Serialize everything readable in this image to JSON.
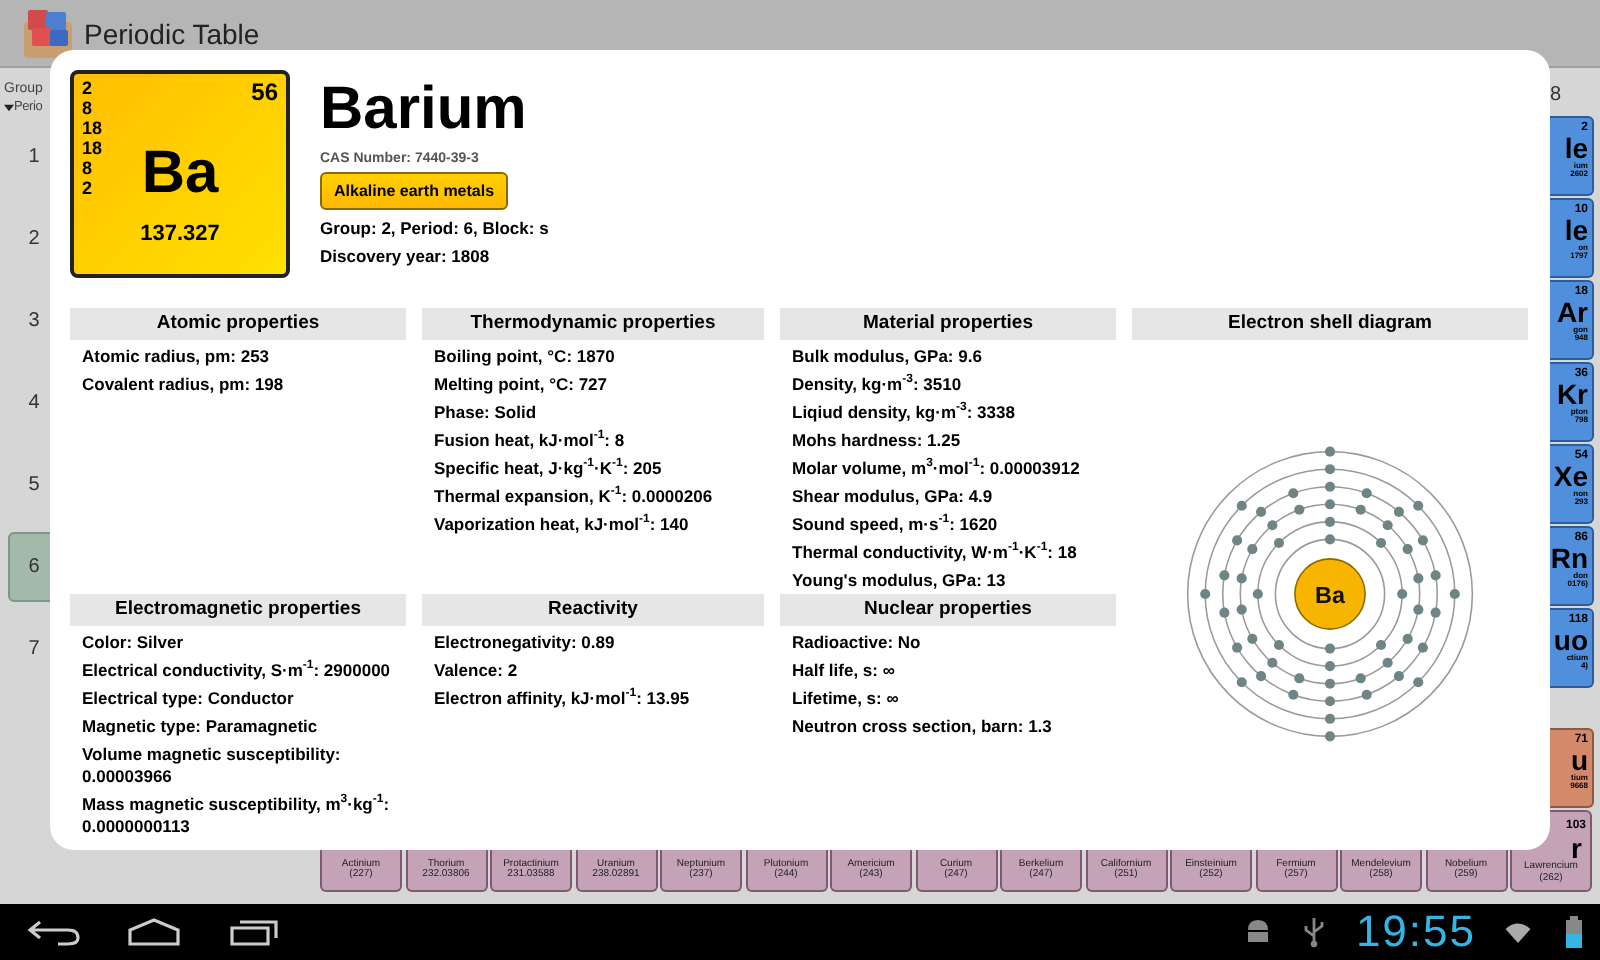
{
  "app_bar": {
    "title": "Periodic Table"
  },
  "sidebar": {
    "group_label": "Group",
    "period_label": "Perio",
    "periods": [
      {
        "label": "1",
        "selected": false
      },
      {
        "label": "2",
        "selected": false
      },
      {
        "label": "3",
        "selected": false
      },
      {
        "label": "4",
        "selected": false
      },
      {
        "label": "5",
        "selected": false
      },
      {
        "label": "6",
        "selected": true
      },
      {
        "label": "7",
        "selected": false
      }
    ]
  },
  "group_header": "8",
  "right_tiles": [
    {
      "number": "2",
      "symbol": "le",
      "name": "ium",
      "mass": "2602",
      "color": "#4f8fdc"
    },
    {
      "number": "10",
      "symbol": "le",
      "name": "on",
      "mass": "1797",
      "color": "#4f8fdc"
    },
    {
      "number": "18",
      "symbol": "Ar",
      "name": "gon",
      "mass": "948",
      "color": "#4f8fdc"
    },
    {
      "number": "36",
      "symbol": "Kr",
      "name": "pton",
      "mass": "798",
      "color": "#4f8fdc"
    },
    {
      "number": "54",
      "symbol": "Xe",
      "name": "non",
      "mass": "293",
      "color": "#4f8fdc"
    },
    {
      "number": "86",
      "symbol": "Rn",
      "name": "don",
      "mass": "0176)",
      "color": "#4f8fdc"
    },
    {
      "number": "118",
      "symbol": "uo",
      "name": "ctium",
      "mass": "4)",
      "color": "#4f8fdc"
    },
    {
      "number": "71",
      "symbol": "u",
      "name": "tium",
      "mass": "9668",
      "color": "#d4896b"
    }
  ],
  "bottom_tiles": [
    {
      "name": "Actinium",
      "mass": "(227)"
    },
    {
      "name": "Thorium",
      "mass": "232.03806"
    },
    {
      "name": "Protactinium",
      "mass": "231.03588"
    },
    {
      "name": "Uranium",
      "mass": "238.02891"
    },
    {
      "name": "Neptunium",
      "mass": "(237)"
    },
    {
      "name": "Plutonium",
      "mass": "(244)"
    },
    {
      "name": "Americium",
      "mass": "(243)"
    },
    {
      "name": "Curium",
      "mass": "(247)"
    },
    {
      "name": "Berkelium",
      "mass": "(247)"
    },
    {
      "name": "Californium",
      "mass": "(251)"
    },
    {
      "name": "Einsteinium",
      "mass": "(252)"
    },
    {
      "name": "Fermium",
      "mass": "(257)"
    },
    {
      "name": "Mendelevium",
      "mass": "(258)"
    },
    {
      "name": "Nobelium",
      "mass": "(259)"
    },
    {
      "name": "Lawrencium",
      "mass": "(262)",
      "number": "103",
      "symbol": "r"
    }
  ],
  "dialog": {
    "tile": {
      "shells": [
        "2",
        "8",
        "18",
        "18",
        "8",
        "2"
      ],
      "number": "56",
      "symbol": "Ba",
      "mass": "137.327"
    },
    "name": "Barium",
    "cas": "CAS Number: 7440-39-3",
    "category": "Alkaline earth metals",
    "classification": "Group: 2,  Period: 6,  Block: s",
    "discovery": "Discovery year: 1808",
    "sections": [
      {
        "title": "Atomic properties",
        "rows": [
          "Atomic radius, pm: 253",
          "Covalent radius, pm: 198"
        ]
      },
      {
        "title": "Thermodynamic properties",
        "rows": [
          "Boiling point, °C: 1870",
          "Melting point, °C: 727",
          "Phase: Solid",
          "Fusion heat, kJ·mol$^{-1}$: 8",
          "Specific heat, J·kg$^{-1}$·K$^{-1}$: 205",
          "Thermal expansion, K$^{-1}$: 0.0000206",
          "Vaporization heat, kJ·mol$^{-1}$: 140"
        ]
      },
      {
        "title": "Material properties",
        "rows": [
          "Bulk modulus, GPa: 9.6",
          "Density, kg·m$^{-3}$: 3510",
          "Liqiud density, kg·m$^{-3}$: 3338",
          "Mohs hardness: 1.25",
          "Molar volume, m$^{3}$·mol$^{-1}$: 0.00003912",
          "Shear modulus, GPa: 4.9",
          "Sound speed, m·s$^{-1}$: 1620",
          "Thermal conductivity, W·m$^{-1}$·K$^{-1}$: 18",
          "Young's modulus, GPa: 13"
        ]
      },
      {
        "title": "Electromagnetic properties",
        "rows": [
          "Color: Silver",
          "Electrical conductivity, S·m$^{-1}$: 2900000",
          "Electrical type: Conductor",
          "Magnetic type: Paramagnetic",
          "Volume magnetic susceptibility: 0.00003966",
          "Mass magnetic susceptibility, m$^{3}$·kg$^{-1}$: 0.0000000113"
        ]
      },
      {
        "title": "Reactivity",
        "rows": [
          "Electronegativity: 0.89",
          "Valence: 2",
          "Electron affinity, kJ·mol$^{-1}$: 13.95"
        ]
      },
      {
        "title": "Nuclear properties",
        "rows": [
          "Radioactive: No",
          "Half life, s: ∞",
          "Lifetime, s: ∞",
          "Neutron cross section, barn: 1.3"
        ]
      }
    ],
    "shell_diagram": {
      "title": "Electron shell diagram",
      "nucleus": "Ba"
    }
  },
  "nav_bar": {
    "time": "19:55"
  }
}
